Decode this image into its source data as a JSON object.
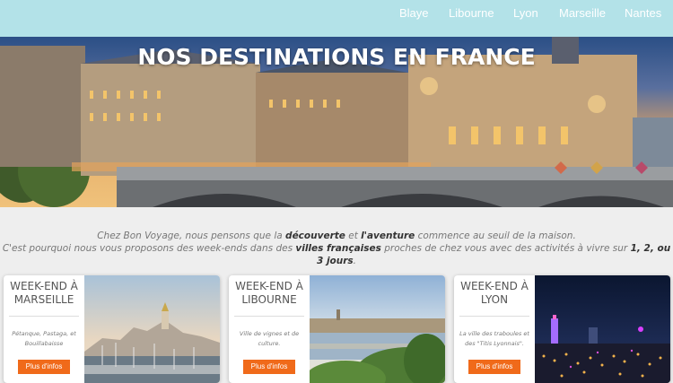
{
  "nav": {
    "items": [
      {
        "label": "Blaye"
      },
      {
        "label": "Libourne"
      },
      {
        "label": "Lyon"
      },
      {
        "label": "Marseille"
      },
      {
        "label": "Nantes"
      }
    ]
  },
  "hero": {
    "title": "NOS DESTINATIONS EN FRANCE"
  },
  "intro": {
    "line1_a": "Chez Bon Voyage, nous pensons que la ",
    "line1_b1": "découverte",
    "line1_c": " et ",
    "line1_b2": "l'aventure",
    "line1_d": " commence au seuil de la maison.",
    "line2_a": "C'est pourquoi nous vous proposons des week-ends dans des ",
    "line2_b1": "villes françaises",
    "line2_c": " proches de chez vous avec des activités à vivre sur ",
    "line2_b2": "1, 2, ou 3 jours",
    "line2_d": "."
  },
  "cards": [
    {
      "title": "WEEK-END À MARSEILLE",
      "desc": "Pétanque, Pastaga, et Bouillabaisse",
      "button": "Plus d'infos"
    },
    {
      "title": "WEEK-END À LIBOURNE",
      "desc": "Ville de vignes et de culture.",
      "button": "Plus d'infos"
    },
    {
      "title": "WEEK-END À LYON",
      "desc": "La ville des traboules et des \"Titis Lyonnais\".",
      "button": "Plus d'infos"
    }
  ],
  "colors": {
    "nav_bg": "#b3e2e8",
    "button": "#f06a1a",
    "page_bg": "#eeeeee"
  }
}
